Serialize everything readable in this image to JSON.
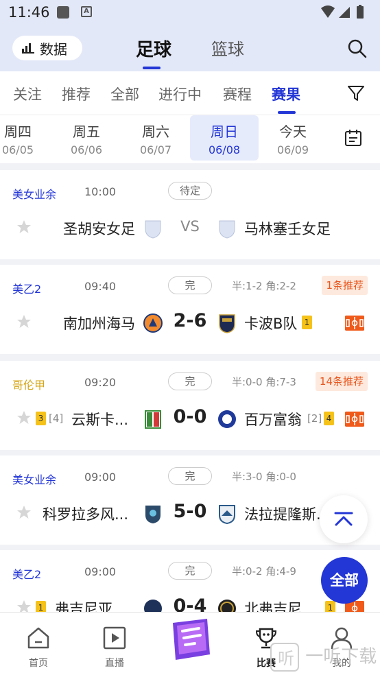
{
  "status_bar": {
    "time": "11:46",
    "sim_icon": "A"
  },
  "header": {
    "data_button": "数据",
    "tabs": [
      "足球",
      "篮球"
    ]
  },
  "filter_tabs": [
    "关注",
    "推荐",
    "全部",
    "进行中",
    "赛程",
    "赛果"
  ],
  "dates": [
    {
      "day": "周四",
      "date": "06/05"
    },
    {
      "day": "周五",
      "date": "06/06"
    },
    {
      "day": "周六",
      "date": "06/07"
    },
    {
      "day": "周日",
      "date": "06/08"
    },
    {
      "day": "今天",
      "date": "06/09"
    }
  ],
  "matches": [
    {
      "league": "美女业余",
      "league_color": "#2336d6",
      "time": "10:00",
      "status": "待定",
      "home": "圣胡安女足",
      "away": "马林塞壬女足",
      "vs": "VS"
    },
    {
      "league": "美乙2",
      "league_color": "#2336d6",
      "time": "09:40",
      "status": "完",
      "half": "半:1-2 角:2-2",
      "rec": "1条推荐",
      "home": "南加州海马",
      "score": "2-6",
      "away": "卡波B队",
      "away_badge": "1"
    },
    {
      "league": "哥伦甲",
      "league_color": "#d4a516",
      "time": "09:20",
      "status": "完",
      "half": "半:0-0 角:7-3",
      "rec": "14条推荐",
      "home": "云斯卡...",
      "home_badge": "3",
      "home_rank": "[4]",
      "score": "0-0",
      "away": "百万富翁",
      "away_rank": "[2]",
      "away_badge": "4"
    },
    {
      "league": "美女业余",
      "league_color": "#2336d6",
      "time": "09:00",
      "status": "完",
      "half": "半:3-0 角:0-0",
      "home": "科罗拉多风...",
      "score": "5-0",
      "away": "法拉提隆斯..."
    },
    {
      "league": "美乙2",
      "league_color": "#2336d6",
      "time": "09:00",
      "status": "完",
      "half": "半:0-2 角:4-9",
      "home": "弗吉尼亚...",
      "home_badge": "1",
      "score": "0-4",
      "away": "北弗吉尼...",
      "away_badge": "1"
    }
  ],
  "floating": {
    "all_button": "全部"
  },
  "bottom_nav": [
    "首页",
    "直播",
    "比赛",
    "我的"
  ],
  "watermark": "一听下载"
}
